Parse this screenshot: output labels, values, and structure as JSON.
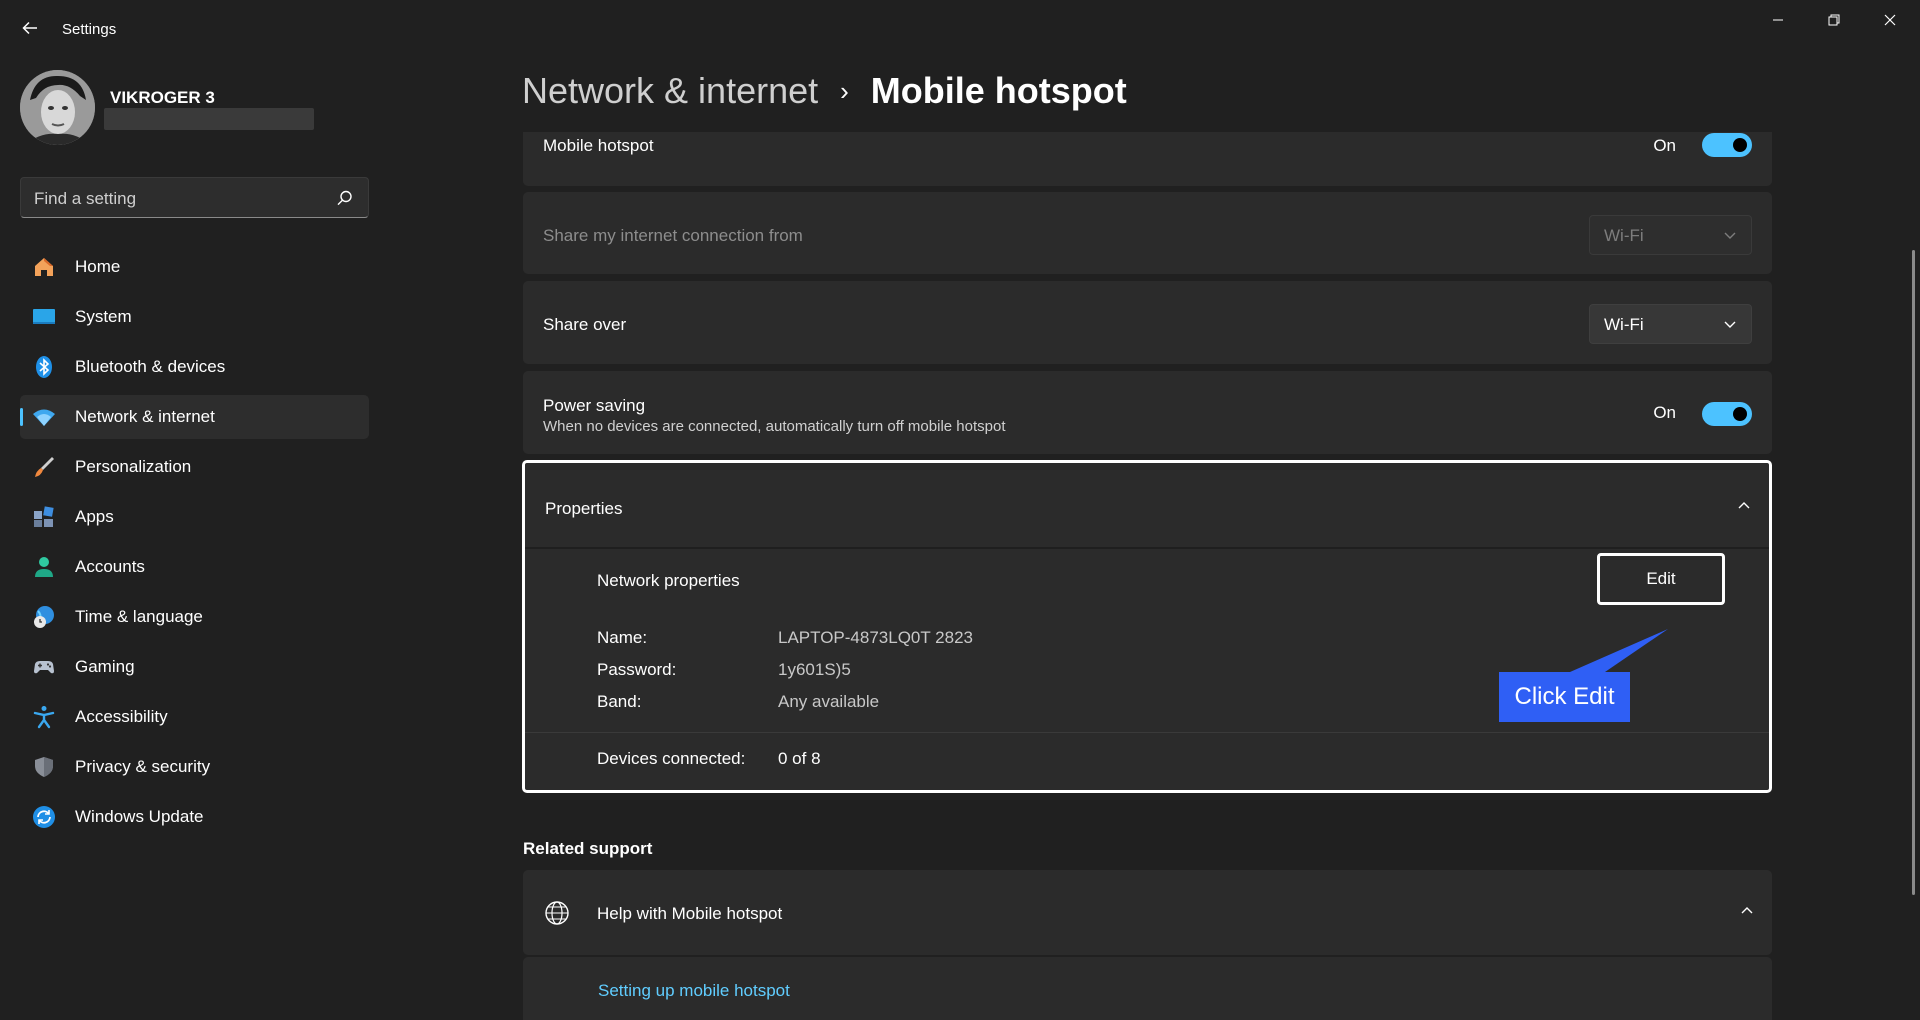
{
  "window": {
    "title": "Settings",
    "controls": [
      "minimize",
      "restore",
      "close"
    ]
  },
  "profile": {
    "name": "VIKROGER 3"
  },
  "search": {
    "placeholder": "Find a setting"
  },
  "sidebar": {
    "items": [
      {
        "label": "Home",
        "icon": "home-icon",
        "active": false
      },
      {
        "label": "System",
        "icon": "system-icon",
        "active": false
      },
      {
        "label": "Bluetooth & devices",
        "icon": "bluetooth-icon",
        "active": false
      },
      {
        "label": "Network & internet",
        "icon": "wifi-icon",
        "active": true
      },
      {
        "label": "Personalization",
        "icon": "brush-icon",
        "active": false
      },
      {
        "label": "Apps",
        "icon": "apps-icon",
        "active": false
      },
      {
        "label": "Accounts",
        "icon": "person-icon",
        "active": false
      },
      {
        "label": "Time & language",
        "icon": "globe-clock-icon",
        "active": false
      },
      {
        "label": "Gaming",
        "icon": "gamepad-icon",
        "active": false
      },
      {
        "label": "Accessibility",
        "icon": "accessibility-icon",
        "active": false
      },
      {
        "label": "Privacy & security",
        "icon": "shield-icon",
        "active": false
      },
      {
        "label": "Windows Update",
        "icon": "update-icon",
        "active": false
      }
    ]
  },
  "breadcrumb": {
    "parent": "Network & internet",
    "separator": "›",
    "current": "Mobile hotspot"
  },
  "hotspot": {
    "label": "Mobile hotspot",
    "state": "On"
  },
  "share_from": {
    "label": "Share my internet connection from",
    "value": "Wi-Fi"
  },
  "share_over": {
    "label": "Share over",
    "value": "Wi-Fi"
  },
  "power_saving": {
    "label": "Power saving",
    "description": "When no devices are connected, automatically turn off mobile hotspot",
    "state": "On"
  },
  "properties": {
    "title": "Properties",
    "network_properties": "Network properties",
    "edit_label": "Edit",
    "name_key": "Name:",
    "name_value": "LAPTOP-4873LQ0T 2823",
    "password_key": "Password:",
    "password_value": "1y601S)5",
    "band_key": "Band:",
    "band_value": "Any available",
    "devices_key": "Devices connected:",
    "devices_value": "0 of 8"
  },
  "annotation": {
    "callout_text": "Click Edit"
  },
  "related": {
    "title": "Related support",
    "help_title": "Help with Mobile hotspot",
    "link": "Setting up mobile hotspot"
  },
  "colors": {
    "background": "#202020",
    "card": "#2b2b2b",
    "accent": "#4cc2ff",
    "callout": "#2f5ff5",
    "link": "#60cdff"
  }
}
